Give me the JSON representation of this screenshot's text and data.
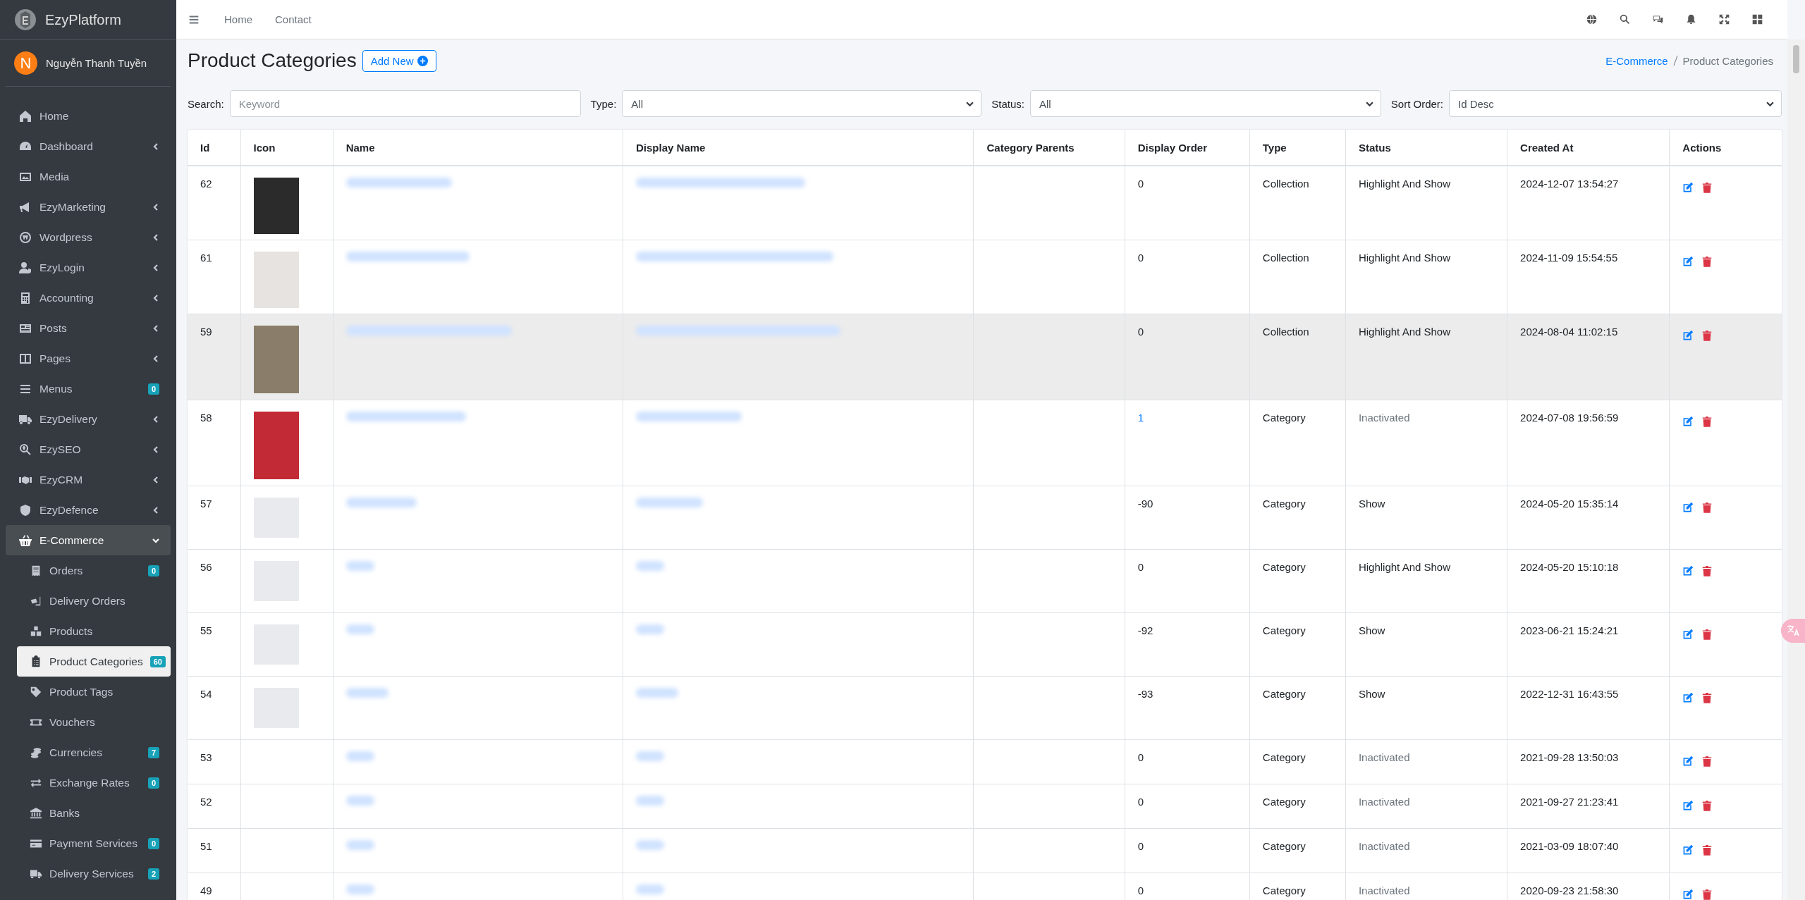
{
  "brand": {
    "name": "EzyPlatform"
  },
  "user": {
    "initial": "N",
    "name": "Nguyễn Thanh Tuyền"
  },
  "sidebar": {
    "items": [
      {
        "label": "Home"
      },
      {
        "label": "Dashboard",
        "expanded": false
      },
      {
        "label": "Media"
      },
      {
        "label": "EzyMarketing",
        "expanded": false
      },
      {
        "label": "Wordpress",
        "expanded": false
      },
      {
        "label": "EzyLogin",
        "expanded": false
      },
      {
        "label": "Accounting",
        "expanded": false
      },
      {
        "label": "Posts",
        "expanded": false
      },
      {
        "label": "Pages",
        "expanded": false
      },
      {
        "label": "Menus",
        "badge": "0"
      },
      {
        "label": "EzyDelivery",
        "expanded": false
      },
      {
        "label": "EzySEO",
        "expanded": false
      },
      {
        "label": "EzyCRM",
        "expanded": false
      },
      {
        "label": "EzyDefence",
        "expanded": false
      },
      {
        "label": "E-Commerce",
        "expanded": true,
        "children": [
          {
            "label": "Orders",
            "badge": "0",
            "selected": false
          },
          {
            "label": "Delivery Orders",
            "selected": false
          },
          {
            "label": "Products",
            "selected": false
          },
          {
            "label": "Product Categories",
            "badge": "60",
            "selected": true
          },
          {
            "label": "Product Tags",
            "selected": false
          },
          {
            "label": "Vouchers",
            "selected": false
          },
          {
            "label": "Currencies",
            "badge": "7",
            "selected": false
          },
          {
            "label": "Exchange Rates",
            "badge": "0",
            "selected": false
          },
          {
            "label": "Banks",
            "selected": false
          },
          {
            "label": "Payment Services",
            "badge": "0",
            "selected": false
          },
          {
            "label": "Delivery Services",
            "badge": "2",
            "selected": false
          }
        ]
      }
    ]
  },
  "topbar": {
    "links": [
      "Home",
      "Contact"
    ]
  },
  "header": {
    "title": "Product Categories",
    "add_button": "Add New",
    "breadcrumb": [
      "E-Commerce",
      "Product Categories"
    ]
  },
  "filters": [
    {
      "kind": "text",
      "label": "Search:",
      "placeholder": "Keyword"
    },
    {
      "kind": "select",
      "label": "Type:",
      "value": "All"
    },
    {
      "kind": "select",
      "label": "Status:",
      "value": "All"
    },
    {
      "kind": "select",
      "label": "Sort Order:",
      "value": "Id Desc"
    }
  ],
  "table": {
    "columns": [
      "Id",
      "Icon",
      "Name",
      "Display Name",
      "Category Parents",
      "Display Order",
      "Type",
      "Status",
      "Created At",
      "Actions"
    ],
    "rows": [
      {
        "id": "62",
        "has_photo": true,
        "display_order": "0",
        "order_link": false,
        "type": "Collection",
        "status": "Highlight And Show",
        "inactive": false,
        "created_at": "2024-12-07 13:54:27",
        "highlighted": false
      },
      {
        "id": "61",
        "has_photo": true,
        "display_order": "0",
        "order_link": false,
        "type": "Collection",
        "status": "Highlight And Show",
        "inactive": false,
        "created_at": "2024-11-09 15:54:55",
        "highlighted": false
      },
      {
        "id": "59",
        "has_photo": true,
        "display_order": "0",
        "order_link": false,
        "type": "Collection",
        "status": "Highlight And Show",
        "inactive": false,
        "created_at": "2024-08-04 11:02:15",
        "highlighted": true
      },
      {
        "id": "58",
        "has_photo": true,
        "display_order": "1",
        "order_link": true,
        "type": "Category",
        "status": "Inactivated",
        "inactive": true,
        "created_at": "2024-07-08 19:56:59",
        "highlighted": false
      },
      {
        "id": "57",
        "has_photo": true,
        "display_order": "-90",
        "order_link": false,
        "type": "Category",
        "status": "Show",
        "inactive": false,
        "created_at": "2024-05-20 15:35:14",
        "highlighted": false
      },
      {
        "id": "56",
        "has_photo": true,
        "display_order": "0",
        "order_link": false,
        "type": "Category",
        "status": "Highlight And Show",
        "inactive": false,
        "created_at": "2024-05-20 15:10:18",
        "highlighted": false
      },
      {
        "id": "55",
        "has_photo": true,
        "display_order": "-92",
        "order_link": false,
        "type": "Category",
        "status": "Show",
        "inactive": false,
        "created_at": "2023-06-21 15:24:21",
        "highlighted": false
      },
      {
        "id": "54",
        "has_photo": true,
        "display_order": "-93",
        "order_link": false,
        "type": "Category",
        "status": "Show",
        "inactive": false,
        "created_at": "2022-12-31 16:43:55",
        "highlighted": false
      },
      {
        "id": "53",
        "has_photo": false,
        "display_order": "0",
        "order_link": false,
        "type": "Category",
        "status": "Inactivated",
        "inactive": true,
        "created_at": "2021-09-28 13:50:03",
        "highlighted": false
      },
      {
        "id": "52",
        "has_photo": false,
        "display_order": "0",
        "order_link": false,
        "type": "Category",
        "status": "Inactivated",
        "inactive": true,
        "created_at": "2021-09-27 21:23:41",
        "highlighted": false
      },
      {
        "id": "51",
        "has_photo": false,
        "display_order": "0",
        "order_link": false,
        "type": "Category",
        "status": "Inactivated",
        "inactive": true,
        "created_at": "2021-03-09 18:07:40",
        "highlighted": false
      },
      {
        "id": "49",
        "has_photo": false,
        "display_order": "0",
        "order_link": false,
        "type": "Category",
        "status": "Inactivated",
        "inactive": true,
        "created_at": "2020-09-23 21:58:30",
        "highlighted": false
      }
    ]
  }
}
